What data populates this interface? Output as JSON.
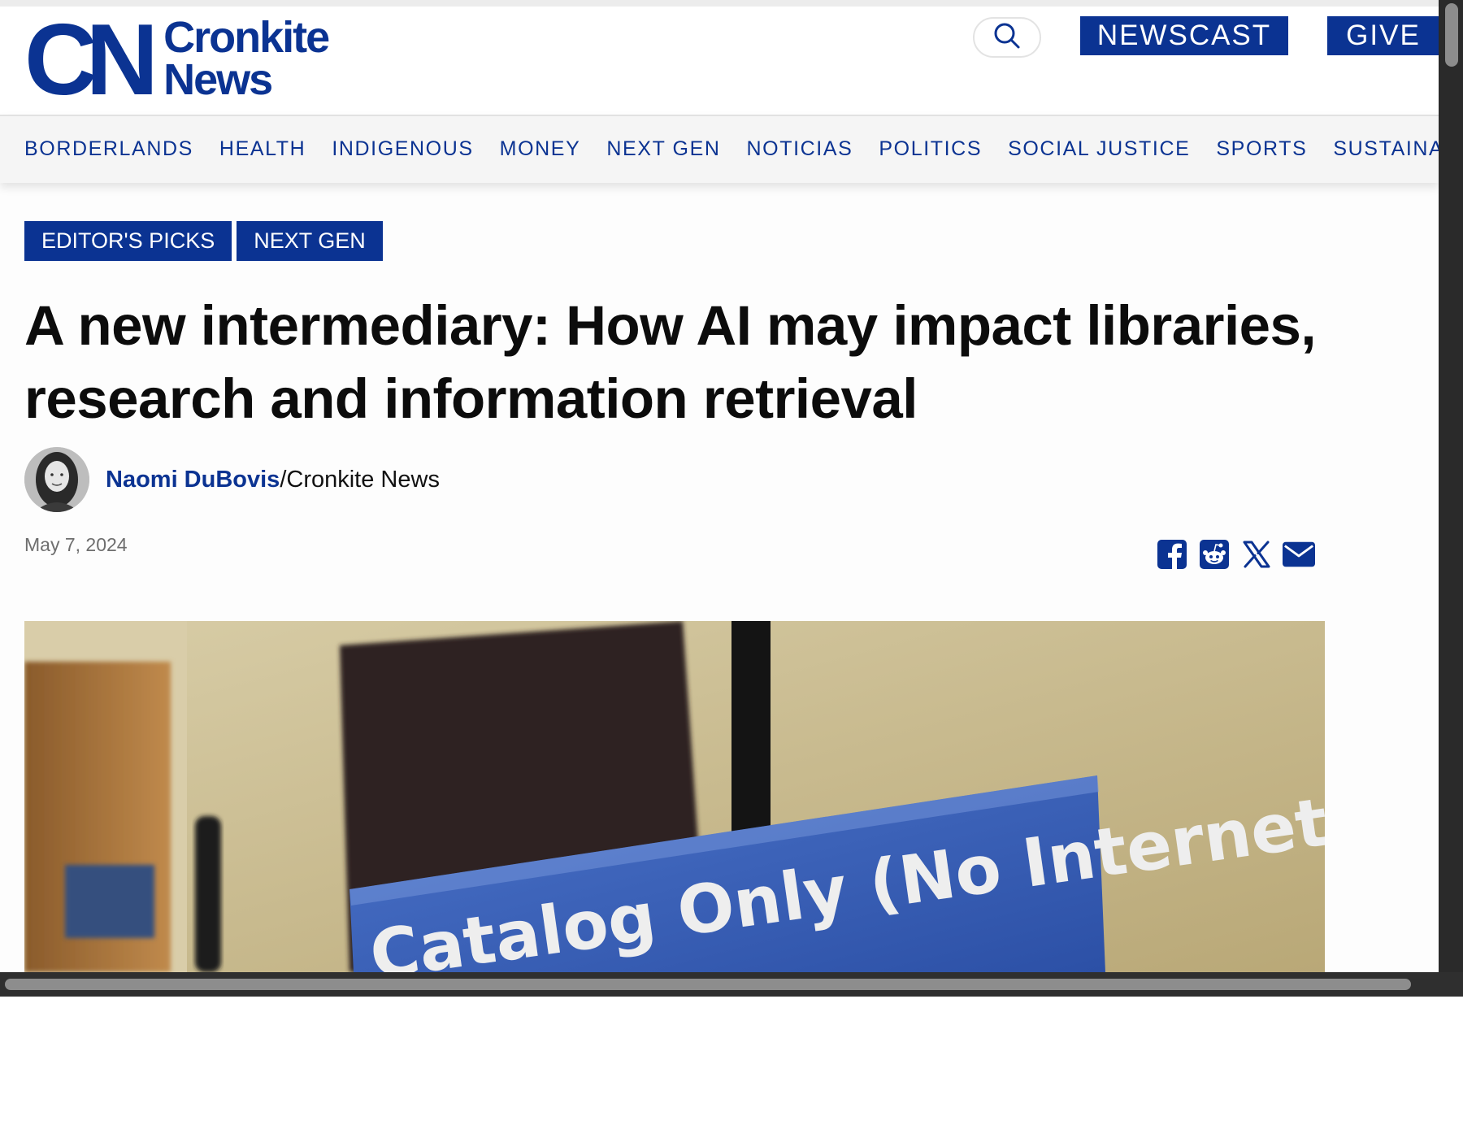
{
  "header": {
    "logo_mark": "CN",
    "logo_line1": "Cronkite",
    "logo_line2": "News",
    "newscast_label": "NEWSCAST",
    "give_label": "GIVE"
  },
  "nav": {
    "items": [
      "BORDERLANDS",
      "HEALTH",
      "INDIGENOUS",
      "MONEY",
      "NEXT GEN",
      "NOTICIAS",
      "POLITICS",
      "SOCIAL JUSTICE",
      "SPORTS",
      "SUSTAINABILITY"
    ]
  },
  "article": {
    "tags": [
      "EDITOR'S PICKS",
      "NEXT GEN"
    ],
    "headline": "A new intermediary: How AI may impact libraries, research and information retrieval",
    "author": "Naomi DuBovis",
    "outlet": "/Cronkite News",
    "date": "May 7, 2024",
    "share_icons": [
      "facebook-icon",
      "reddit-icon",
      "x-icon",
      "email-icon"
    ],
    "hero_sign_text": "Catalog Only (No Internet)"
  },
  "colors": {
    "brand_blue": "#0b3392",
    "headline": "#0c0c0c",
    "nav_bg": "#f5f5f5"
  }
}
